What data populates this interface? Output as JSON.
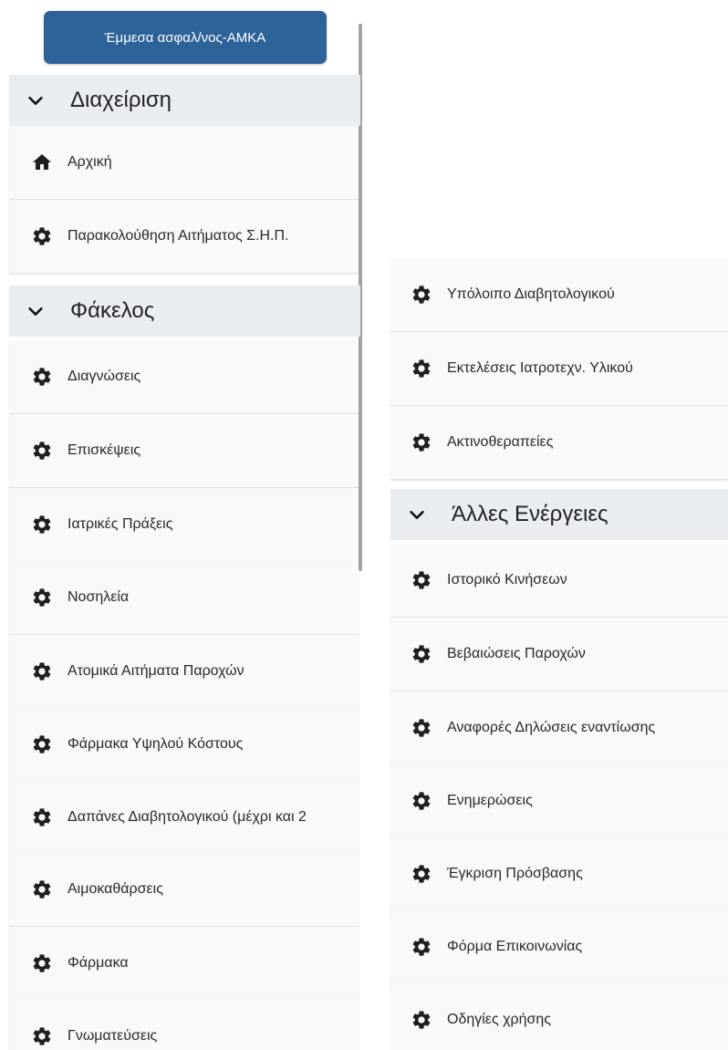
{
  "top_button": {
    "label": "Έμμεσα ασφαλ/νος-ΑΜΚΑ"
  },
  "left_panel": {
    "section_management": {
      "title": "Διαχείριση",
      "items": [
        {
          "label": "Αρχική",
          "icon": "home-icon"
        },
        {
          "label": "Παρακολούθηση Αιτήματος Σ.Η.Π.",
          "icon": "gear-icon"
        }
      ]
    },
    "section_folder": {
      "title": "Φάκελος",
      "items": [
        {
          "label": "Διαγνώσεις",
          "icon": "gear-icon"
        },
        {
          "label": "Επισκέψεις",
          "icon": "gear-icon"
        },
        {
          "label": "Ιατρικές Πράξεις",
          "icon": "gear-icon"
        },
        {
          "label": "Νοσηλεία",
          "icon": "gear-icon"
        },
        {
          "label": "Ατομικά Αιτήματα Παροχών",
          "icon": "gear-icon"
        },
        {
          "label": "Φάρμακα Υψηλού Κόστους",
          "icon": "gear-icon"
        },
        {
          "label": "Δαπάνες Διαβητολογικού (μέχρι και 2",
          "icon": "gear-icon"
        },
        {
          "label": "Αιμοκαθάρσεις",
          "icon": "gear-icon"
        },
        {
          "label": "Φάρμακα",
          "icon": "gear-icon"
        },
        {
          "label": "Γνωματεύσεις",
          "icon": "gear-icon"
        }
      ]
    }
  },
  "right_panel": {
    "folder_continued": {
      "items": [
        {
          "label": "Υπόλοιπο Διαβητολογικού",
          "icon": "gear-icon"
        },
        {
          "label": "Εκτελέσεις Ιατροτεχν. Υλικού",
          "icon": "gear-icon"
        },
        {
          "label": "Ακτινοθεραπείες",
          "icon": "gear-icon"
        }
      ]
    },
    "section_other": {
      "title": "Άλλες Ενέργειες",
      "items": [
        {
          "label": "Ιστορικό Κινήσεων",
          "icon": "gear-icon"
        },
        {
          "label": "Βεβαιώσεις Παροχών",
          "icon": "gear-icon"
        },
        {
          "label": "Αναφορές Δηλώσεις εναντίωσης",
          "icon": "gear-icon"
        },
        {
          "label": "Ενημερώσεις",
          "icon": "gear-icon"
        },
        {
          "label": "Έγκριση Πρόσβασης",
          "icon": "gear-icon"
        },
        {
          "label": "Φόρμα Επικοινωνίας",
          "icon": "gear-icon"
        },
        {
          "label": "Οδηγίες χρήσης",
          "icon": "gear-icon"
        }
      ]
    }
  },
  "colors": {
    "primary_button": "#2d6399",
    "section_header_bg": "#e9edf2",
    "item_bg": "#f9f9fa",
    "icon": "#1f1f1f"
  }
}
